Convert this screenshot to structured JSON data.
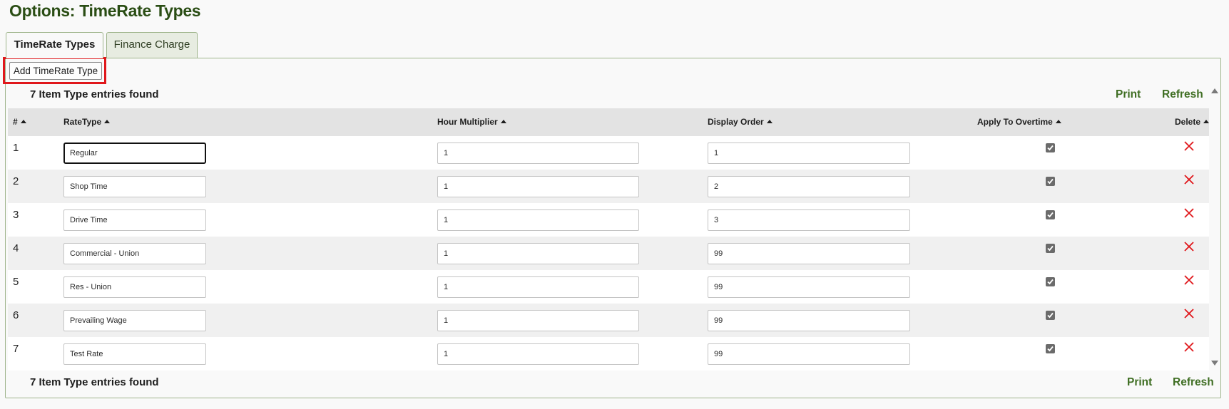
{
  "page": {
    "title": "Options: TimeRate Types"
  },
  "tabs": [
    {
      "label": "TimeRate Types",
      "active": true
    },
    {
      "label": "Finance Charge",
      "active": false
    }
  ],
  "toolbar": {
    "add_label": "Add TimeRate Type"
  },
  "summary": {
    "count_text": "7 Item Type entries found",
    "print_label": "Print",
    "refresh_label": "Refresh"
  },
  "table": {
    "headers": {
      "num": "#",
      "ratetype": "RateType",
      "hour_multiplier": "Hour Multiplier",
      "display_order": "Display Order",
      "apply_overtime": "Apply To Overtime",
      "delete": "Delete"
    },
    "rows": [
      {
        "num": "1",
        "ratetype": "Regular",
        "hour_multiplier": "1",
        "display_order": "1",
        "apply_overtime": true
      },
      {
        "num": "2",
        "ratetype": "Shop Time",
        "hour_multiplier": "1",
        "display_order": "2",
        "apply_overtime": true
      },
      {
        "num": "3",
        "ratetype": "Drive Time",
        "hour_multiplier": "1",
        "display_order": "3",
        "apply_overtime": true
      },
      {
        "num": "4",
        "ratetype": "Commercial - Union",
        "hour_multiplier": "1",
        "display_order": "99",
        "apply_overtime": true
      },
      {
        "num": "5",
        "ratetype": "Res - Union",
        "hour_multiplier": "1",
        "display_order": "99",
        "apply_overtime": true
      },
      {
        "num": "6",
        "ratetype": "Prevailing Wage",
        "hour_multiplier": "1",
        "display_order": "99",
        "apply_overtime": true
      },
      {
        "num": "7",
        "ratetype": "Test Rate",
        "hour_multiplier": "1",
        "display_order": "99",
        "apply_overtime": true
      }
    ]
  },
  "colors": {
    "title_green": "#2a4d14",
    "link_green": "#3f6e23",
    "highlight_red": "#e0171b",
    "delete_red": "#e0171b"
  },
  "icons": {
    "sort": "sort-up-caret-icon",
    "delete": "close-x-icon",
    "checkbox": "checkmark-icon"
  }
}
